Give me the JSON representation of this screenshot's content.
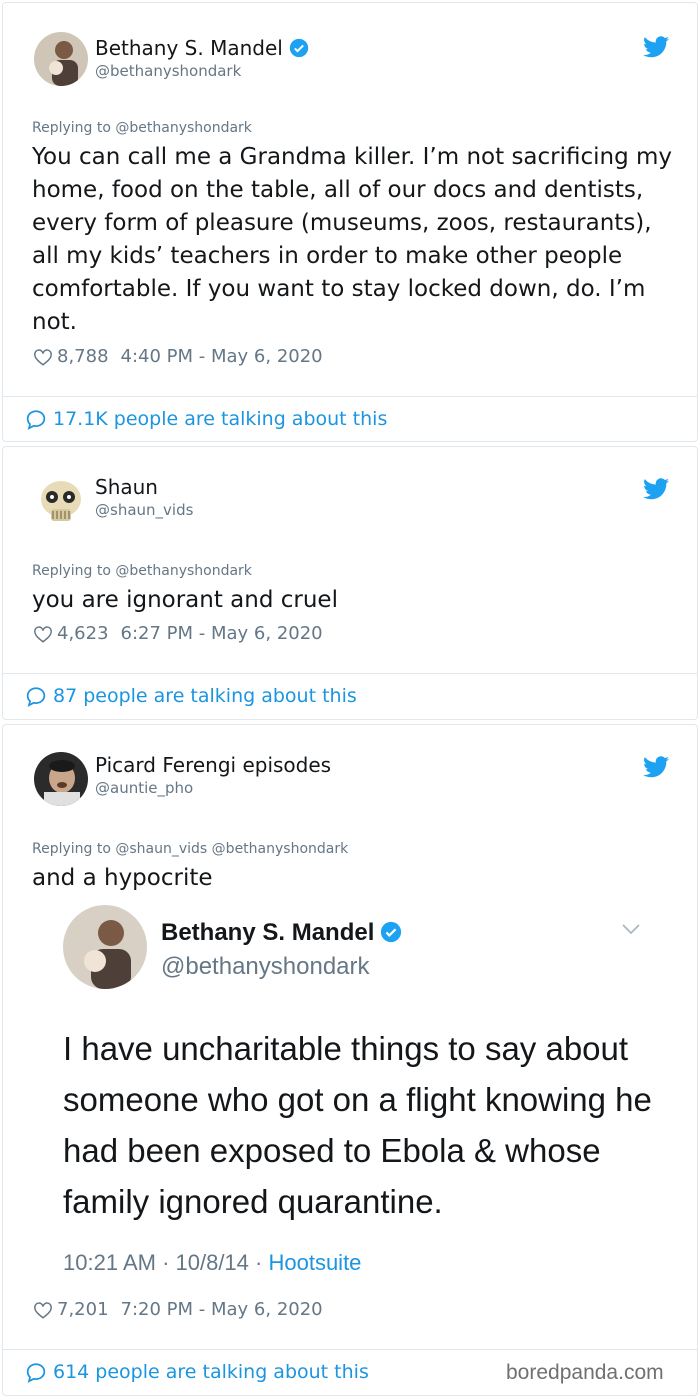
{
  "tweets": [
    {
      "author": "Bethany S. Mandel",
      "handle": "@bethanyshondark",
      "verified": true,
      "replying_to": "Replying to @bethanyshondark",
      "text": "You can call me a Grandma killer. I’m not sacrificing my home, food on the table, all of our docs and dentists, every form of pleasure (museums, zoos, restaurants), all my kids’ teachers in order to make other people comfortable. If you want to stay locked down, do. I’m not.",
      "likes": "8,788",
      "timestamp": "4:40 PM - May 6, 2020",
      "talking": "17.1K people are talking about this"
    },
    {
      "author": "Shaun",
      "handle": "@shaun_vids",
      "replying_to": "Replying to @bethanyshondark",
      "text": "you are ignorant and cruel",
      "likes": "4,623",
      "timestamp": "6:27 PM - May 6, 2020",
      "talking": "87 people are talking about this"
    },
    {
      "author": "Picard Ferengi episodes",
      "handle": "@auntie_pho",
      "replying_to": "Replying to @shaun_vids @bethanyshondark",
      "text": "and a hypocrite",
      "quoted": {
        "author": "Bethany S. Mandel",
        "handle": "@bethanyshondark",
        "verified": true,
        "text": "I have uncharitable things to say about someone who got on a flight knowing he had been exposed to Ebola & whose family ignored quarantine.",
        "time": "10:21 AM · 10/8/14 · ",
        "source": "Hootsuite"
      },
      "likes": "7,201",
      "timestamp": "7:20 PM - May 6, 2020",
      "talking": "614 people are talking about this"
    }
  ],
  "watermark": "boredpanda.com",
  "colors": {
    "twitter_blue": "#1da1f2",
    "link_blue": "#1b95e0",
    "muted": "#657786",
    "border": "#e1e8ed"
  }
}
